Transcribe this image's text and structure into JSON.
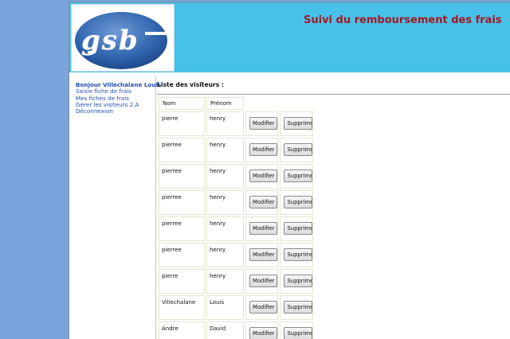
{
  "header": {
    "title": "Suivi du remboursement des frais",
    "logo_text": "gsb"
  },
  "menu": {
    "greeting": "Bonjour Villechalane Louis",
    "items": [
      "Saisie fiche de frais",
      "Mes fiches de frais",
      "Gérer les visiteurs 2.A",
      "Déconnexion"
    ]
  },
  "main": {
    "title": "Liste des visiteurs :",
    "columns": [
      "Nom",
      "Prénom"
    ],
    "modify_label": "Modifier",
    "delete_label": "Supprimer",
    "rows": [
      {
        "nom": "pierre",
        "prenom": "henry"
      },
      {
        "nom": "pierree",
        "prenom": "henry"
      },
      {
        "nom": "pierree",
        "prenom": "henry"
      },
      {
        "nom": "pierree",
        "prenom": "henry"
      },
      {
        "nom": "pierree",
        "prenom": "henry"
      },
      {
        "nom": "pierree",
        "prenom": "henry"
      },
      {
        "nom": "pierre",
        "prenom": "henry"
      },
      {
        "nom": "Villechalane",
        "prenom": "Louis"
      },
      {
        "nom": "Andre",
        "prenom": "David"
      }
    ]
  },
  "colors": {
    "page_background": "#77a5dc",
    "header_background": "#47c0ea",
    "title_color": "#a5191e",
    "link_color": "#2150b5"
  }
}
